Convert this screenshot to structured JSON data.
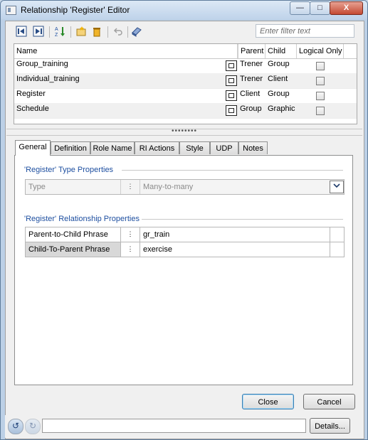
{
  "window": {
    "title": "Relationship 'Register' Editor",
    "min_label": "—",
    "max_label": "□",
    "close_label": "X"
  },
  "toolbar": {
    "icons": [
      "prev-record-icon",
      "next-record-icon",
      "sort-icon",
      "new-icon",
      "delete-icon",
      "undo-icon",
      "properties-icon"
    ]
  },
  "filter": {
    "placeholder": "Enter filter text"
  },
  "grid": {
    "columns": [
      "Name",
      "Parent",
      "Child",
      "Logical Only"
    ],
    "rows": [
      {
        "name": "Group_training",
        "parent": "Trener",
        "child": "Group",
        "logical_only": false
      },
      {
        "name": "Individual_training",
        "parent": "Trener",
        "child": "Client",
        "logical_only": false
      },
      {
        "name": "Register",
        "parent": "Client",
        "child": "Group",
        "logical_only": false
      },
      {
        "name": "Schedule",
        "parent": "Group",
        "child": "Graphic",
        "logical_only": false
      }
    ]
  },
  "tabs": [
    "General",
    "Definition",
    "Role Name",
    "RI Actions",
    "Style",
    "UDP",
    "Notes"
  ],
  "active_tab": "General",
  "general": {
    "type_group_title": "'Register' Type Properties",
    "type_label": "Type",
    "type_value": "Many-to-many",
    "rel_group_title": "'Register' Relationship Properties",
    "parent_to_child_label": "Parent-to-Child Phrase",
    "parent_to_child_value": "gr_train",
    "child_to_parent_label": "Child-To-Parent Phrase",
    "child_to_parent_value": "exercise"
  },
  "buttons": {
    "close": "Close",
    "cancel": "Cancel",
    "details": "Details..."
  }
}
